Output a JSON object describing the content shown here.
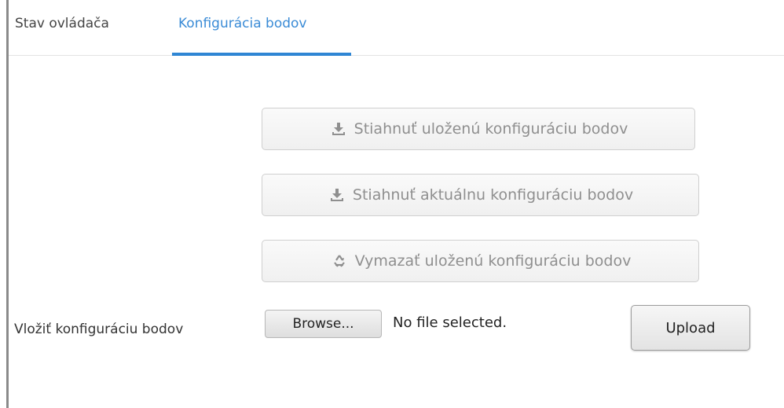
{
  "tabs": [
    {
      "label": "Stav ovládača",
      "active": false
    },
    {
      "label": "Konfigurácia bodov",
      "active": true
    }
  ],
  "colors": {
    "accent": "#2f86d4",
    "active_tab_text": "#3a8bd6",
    "disabled_text": "#8f8f8f"
  },
  "actions": {
    "download_saved": {
      "label": "Stiahnuť uloženú konfiguráciu bodov",
      "icon": "download-icon"
    },
    "download_current": {
      "label": "Stiahnuť aktuálnu konfiguráciu bodov",
      "icon": "download-icon"
    },
    "delete_saved": {
      "label": "Vymazať uloženú konfiguráciu bodov",
      "icon": "recycle-icon"
    }
  },
  "upload": {
    "label": "Vložiť konfiguráciu bodov",
    "browse_label": "Browse...",
    "file_status": "No file selected.",
    "upload_label": "Upload"
  }
}
